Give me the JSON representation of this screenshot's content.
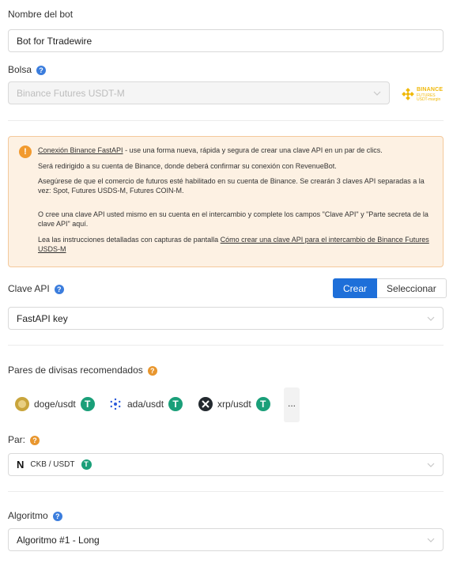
{
  "bot_name": {
    "label": "Nombre del bot",
    "value": "Bot for Ttradewire"
  },
  "exchange": {
    "label": "Bolsa",
    "value": "Binance Futures USDT-M",
    "logo_text": "BINANCE",
    "logo_sub1": "FUTURES",
    "logo_sub2": "USDT-margin"
  },
  "notice": {
    "link1": "Conexión Binance FastAPI",
    "line1_rest": " - use una forma nueva, rápida y segura de crear una clave API en un par de clics.",
    "line2": "Será redirigido a su cuenta de Binance, donde deberá confirmar su conexión con RevenueBot.",
    "line3": "Asegúrese de que el comercio de futuros esté habilitado en su cuenta de Binance. Se crearán 3 claves API separadas a la vez: Spot, Futures USDS-M, Futures COIN-M.",
    "line4": "O cree una clave API usted mismo en su cuenta en el intercambio y complete los campos \"Clave API\" y \"Parte secreta de la clave API\" aquí.",
    "line5_pre": "Lea las instrucciones detalladas con capturas de pantalla ",
    "link2": "Cómo crear una clave API para el intercambio de Binance Futures USDS-M"
  },
  "api_key": {
    "label": "Clave API",
    "create_label": "Crear",
    "select_label": "Seleccionar",
    "value": "FastAPI key"
  },
  "recommended_pairs": {
    "label": "Pares de divisas recomendados",
    "items": [
      {
        "name": "doge/usdt",
        "quote_icon": "T"
      },
      {
        "name": "ada/usdt",
        "quote_icon": "T"
      },
      {
        "name": "xrp/usdt",
        "quote_icon": "T"
      }
    ],
    "more_label": "..."
  },
  "pair": {
    "label": "Par:",
    "value": "CKB / USDT",
    "quote_icon": "T"
  },
  "algorithm": {
    "label": "Algoritmo",
    "value": "Algoritmo #1 - Long"
  },
  "colors": {
    "primary": "#1e6fd9",
    "help_blue": "#3b7ddd",
    "help_orange": "#e8962e",
    "tether": "#1a9f79",
    "notice_bg": "#fdf1e3",
    "binance_yellow": "#f0b90b"
  }
}
